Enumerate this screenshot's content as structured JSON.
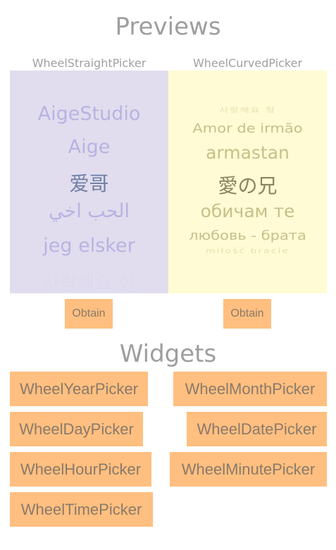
{
  "previews": {
    "title": "Previews",
    "straight": {
      "caption": "WheelStraightPicker",
      "items": [
        "AigeStudio",
        "Aige",
        "爱哥",
        "الحب اخي",
        "jeg elsker",
        "사랑해요 형"
      ],
      "selected_index": 2,
      "obtain_label": "Obtain"
    },
    "curved": {
      "caption": "WheelCurvedPicker",
      "items": [
        "사랑해요 형",
        "Amor de irmão",
        "armastan",
        "愛の兄",
        "обичам те",
        "любовь - брата",
        "miłość bracie"
      ],
      "selected_index": 3,
      "obtain_label": "Obtain"
    }
  },
  "widgets": {
    "title": "Widgets",
    "buttons": [
      "WheelYearPicker",
      "WheelMonthPicker",
      "WheelDayPicker",
      "WheelDatePicker",
      "WheelHourPicker",
      "WheelMinutePicker",
      "WheelTimePicker"
    ]
  },
  "colors": {
    "button_bg": "#ffbf80",
    "straight_bg": "#e1ddee",
    "curved_bg": "#fffbd4"
  }
}
